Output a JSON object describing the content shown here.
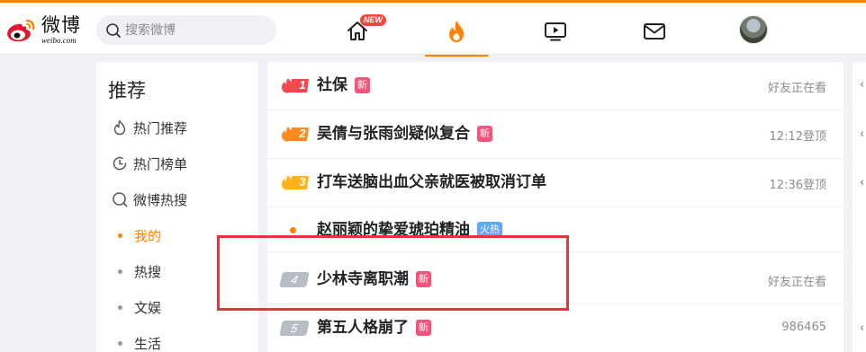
{
  "header": {
    "logo_text": "微博",
    "logo_url": "weibo.com",
    "search_placeholder": "搜索微博",
    "home_badge": "NEW"
  },
  "sidebar": {
    "title": "推荐",
    "items": [
      {
        "label": "热门推荐",
        "icon": "flame-outline-icon"
      },
      {
        "label": "热门榜单",
        "icon": "clock-rank-icon"
      },
      {
        "label": "微博热搜",
        "icon": "search-hot-icon"
      },
      {
        "label": "我的",
        "icon": "dot"
      },
      {
        "label": "热搜",
        "icon": "dot"
      },
      {
        "label": "文娱",
        "icon": "dot"
      },
      {
        "label": "生活",
        "icon": "dot"
      }
    ]
  },
  "hot_list": [
    {
      "rank": "1",
      "title": "社保",
      "tag": "新",
      "meta": "好友正在看",
      "rank_color": "#f2484e"
    },
    {
      "rank": "2",
      "title": "吴倩与张雨剑疑似复合",
      "tag": "新",
      "meta": "12:12登顶",
      "rank_color": "#ff8a1d"
    },
    {
      "rank": "3",
      "title": "打车送脑出血父亲就医被取消订单",
      "tag": "",
      "meta": "12:36登顶",
      "rank_color": "#ffb319"
    },
    {
      "rank": "",
      "title": "赵丽颖的挚爱琥珀精油",
      "tag": "火热",
      "meta": ""
    },
    {
      "rank": "4",
      "title": "少林寺离职潮",
      "tag": "新",
      "meta": "好友正在看"
    },
    {
      "rank": "5",
      "title": "第五人格崩了",
      "tag": "新",
      "meta": "986465"
    }
  ],
  "colors": {
    "accent": "#ff8200",
    "highlight_box": "#e8353b",
    "tag_new": "#f2547a",
    "tag_hot": "#5fa8f5"
  }
}
